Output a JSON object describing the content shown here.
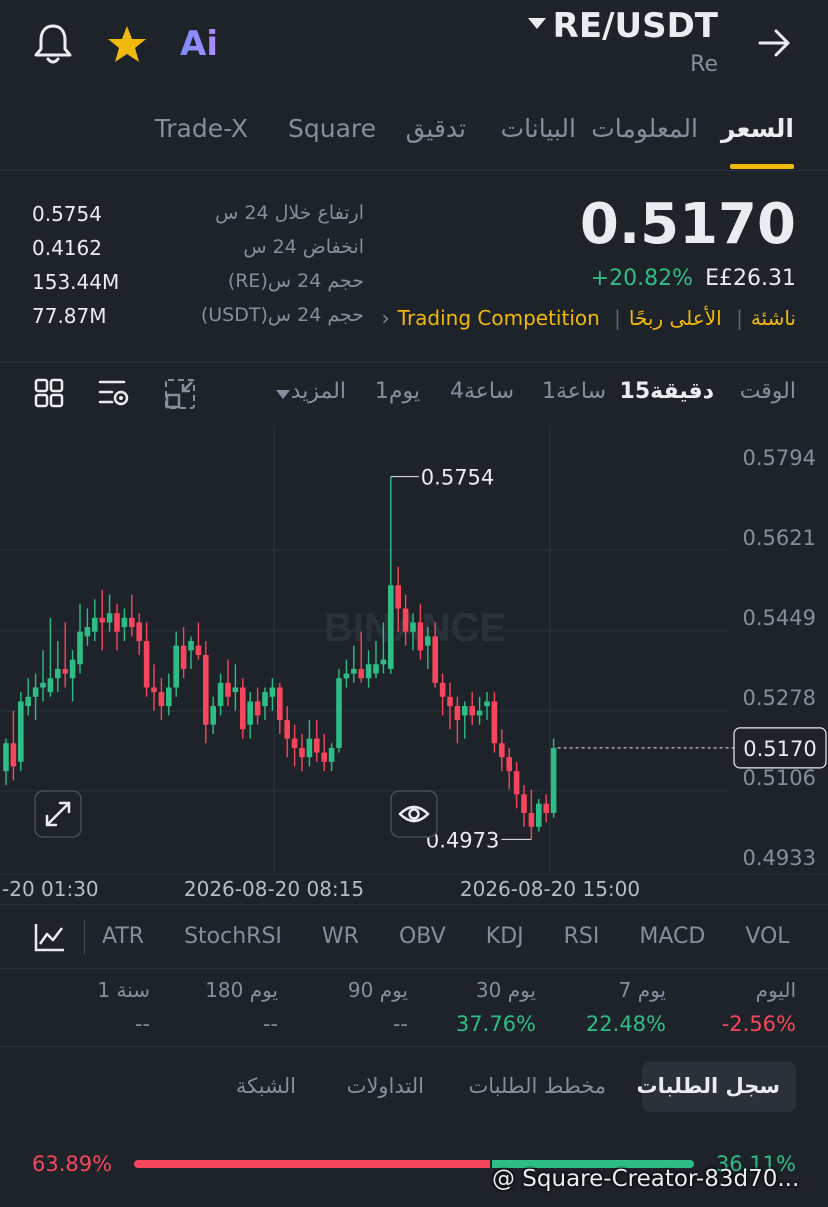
{
  "header": {
    "pair": "RE/USDT",
    "base_name": "Re",
    "ai_label": "Ai"
  },
  "tabs": [
    {
      "label": "السعر",
      "active": true
    },
    {
      "label": "المعلومات",
      "active": false
    },
    {
      "label": "البيانات",
      "active": false
    },
    {
      "label": "تدقيق",
      "active": false
    },
    {
      "label": "Square",
      "active": false
    },
    {
      "label": "Trade-X",
      "active": false
    }
  ],
  "stats": {
    "high_label": "ارتفاع خلال 24 س",
    "high_value": "0.5754",
    "low_label": "انخفاض 24 س",
    "low_value": "0.4162",
    "vol_base_label": "حجم 24 س(RE)",
    "vol_base_value": "153.44M",
    "vol_quote_label": "حجم 24 س(USDT)",
    "vol_quote_value": "77.87M"
  },
  "price": {
    "last": "0.5170",
    "change_pct": "+20.82%",
    "fiat": "E£26.31"
  },
  "tags": [
    "ناشئة",
    "الأعلى ربحًا",
    "Trading Competition"
  ],
  "timeframes": {
    "time_label": "الوقت",
    "items": [
      "15دقيقة",
      "1ساعة",
      "4ساعة",
      "1يوم"
    ],
    "active": "15دقيقة",
    "more_label": "المزيد"
  },
  "chart_data": {
    "type": "candlestick",
    "pair": "RE/USDT",
    "interval": "15m",
    "y_ticks": [
      "0.5794",
      "0.5621",
      "0.5449",
      "0.5278",
      "0.5106",
      "0.4933"
    ],
    "x_ticks": [
      "-20 01:30",
      "2026-08-20 08:15",
      "2026-08-20 15:00"
    ],
    "ylim": [
      0.4933,
      0.5794
    ],
    "last_price_label": "0.5170",
    "high_marker": "0.5754",
    "low_marker": "0.4973",
    "watermark": "BINANCE",
    "candles": [
      [
        0.512,
        0.519,
        0.509,
        0.518
      ],
      [
        0.518,
        0.525,
        0.51,
        0.513
      ],
      [
        0.514,
        0.529,
        0.512,
        0.527
      ],
      [
        0.526,
        0.532,
        0.524,
        0.528
      ],
      [
        0.528,
        0.533,
        0.523,
        0.53
      ],
      [
        0.53,
        0.538,
        0.527,
        0.531
      ],
      [
        0.529,
        0.545,
        0.528,
        0.532
      ],
      [
        0.532,
        0.54,
        0.529,
        0.534
      ],
      [
        0.534,
        0.544,
        0.53,
        0.533
      ],
      [
        0.532,
        0.538,
        0.527,
        0.536
      ],
      [
        0.535,
        0.548,
        0.533,
        0.542
      ],
      [
        0.541,
        0.547,
        0.539,
        0.543
      ],
      [
        0.542,
        0.549,
        0.54,
        0.545
      ],
      [
        0.545,
        0.551,
        0.538,
        0.544
      ],
      [
        0.544,
        0.55,
        0.542,
        0.546
      ],
      [
        0.546,
        0.548,
        0.538,
        0.542
      ],
      [
        0.543,
        0.547,
        0.54,
        0.545
      ],
      [
        0.545,
        0.55,
        0.541,
        0.543
      ],
      [
        0.544,
        0.546,
        0.537,
        0.54
      ],
      [
        0.54,
        0.544,
        0.528,
        0.53
      ],
      [
        0.53,
        0.535,
        0.525,
        0.529
      ],
      [
        0.529,
        0.532,
        0.523,
        0.526
      ],
      [
        0.526,
        0.533,
        0.524,
        0.53
      ],
      [
        0.53,
        0.542,
        0.528,
        0.539
      ],
      [
        0.539,
        0.543,
        0.532,
        0.534
      ],
      [
        0.538,
        0.541,
        0.534,
        0.54
      ],
      [
        0.539,
        0.544,
        0.536,
        0.537
      ],
      [
        0.537,
        0.54,
        0.518,
        0.522
      ],
      [
        0.522,
        0.528,
        0.52,
        0.526
      ],
      [
        0.526,
        0.533,
        0.524,
        0.531
      ],
      [
        0.531,
        0.536,
        0.526,
        0.528
      ],
      [
        0.529,
        0.535,
        0.525,
        0.53
      ],
      [
        0.53,
        0.532,
        0.519,
        0.521
      ],
      [
        0.522,
        0.529,
        0.519,
        0.527
      ],
      [
        0.527,
        0.53,
        0.522,
        0.524
      ],
      [
        0.526,
        0.53,
        0.523,
        0.529
      ],
      [
        0.528,
        0.532,
        0.525,
        0.53
      ],
      [
        0.53,
        0.531,
        0.52,
        0.523
      ],
      [
        0.523,
        0.526,
        0.515,
        0.519
      ],
      [
        0.519,
        0.522,
        0.513,
        0.517
      ],
      [
        0.517,
        0.52,
        0.512,
        0.515
      ],
      [
        0.515,
        0.523,
        0.513,
        0.519
      ],
      [
        0.519,
        0.523,
        0.514,
        0.516
      ],
      [
        0.516,
        0.52,
        0.512,
        0.514
      ],
      [
        0.514,
        0.518,
        0.512,
        0.517
      ],
      [
        0.517,
        0.534,
        0.516,
        0.532
      ],
      [
        0.532,
        0.536,
        0.53,
        0.533
      ],
      [
        0.533,
        0.539,
        0.531,
        0.534
      ],
      [
        0.534,
        0.542,
        0.531,
        0.532
      ],
      [
        0.532,
        0.538,
        0.53,
        0.535
      ],
      [
        0.533,
        0.54,
        0.532,
        0.535
      ],
      [
        0.535,
        0.544,
        0.533,
        0.536
      ],
      [
        0.534,
        0.5754,
        0.533,
        0.552
      ],
      [
        0.552,
        0.556,
        0.542,
        0.547
      ],
      [
        0.547,
        0.55,
        0.539,
        0.542
      ],
      [
        0.542,
        0.546,
        0.538,
        0.544
      ],
      [
        0.544,
        0.548,
        0.536,
        0.538
      ],
      [
        0.539,
        0.543,
        0.534,
        0.541
      ],
      [
        0.541,
        0.544,
        0.53,
        0.531
      ],
      [
        0.531,
        0.533,
        0.524,
        0.528
      ],
      [
        0.528,
        0.531,
        0.521,
        0.526
      ],
      [
        0.526,
        0.528,
        0.518,
        0.523
      ],
      [
        0.524,
        0.527,
        0.519,
        0.526
      ],
      [
        0.526,
        0.529,
        0.522,
        0.524
      ],
      [
        0.524,
        0.528,
        0.522,
        0.525
      ],
      [
        0.526,
        0.529,
        0.523,
        0.527
      ],
      [
        0.527,
        0.529,
        0.516,
        0.518
      ],
      [
        0.518,
        0.521,
        0.512,
        0.515
      ],
      [
        0.515,
        0.517,
        0.508,
        0.512
      ],
      [
        0.512,
        0.514,
        0.504,
        0.507
      ],
      [
        0.507,
        0.509,
        0.5,
        0.503
      ],
      [
        0.503,
        0.508,
        0.4973,
        0.5
      ],
      [
        0.5,
        0.506,
        0.499,
        0.505
      ],
      [
        0.505,
        0.507,
        0.501,
        0.503
      ],
      [
        0.503,
        0.519,
        0.502,
        0.517
      ]
    ]
  },
  "indicators": [
    "ATR",
    "StochRSI",
    "WR",
    "OBV",
    "KDJ",
    "RSI",
    "MACD",
    "VOL"
  ],
  "performance": [
    {
      "label": "اليوم",
      "value": "-2.56%",
      "color": "#f6465d"
    },
    {
      "label": "7 يوم",
      "value": "22.48%",
      "color": "#2ebd85"
    },
    {
      "label": "30 يوم",
      "value": "37.76%",
      "color": "#2ebd85"
    },
    {
      "label": "90 يوم",
      "value": "--",
      "color": "#848e9c"
    },
    {
      "label": "180 يوم",
      "value": "--",
      "color": "#848e9c"
    },
    {
      "label": "1 سنة",
      "value": "--",
      "color": "#848e9c"
    }
  ],
  "order_tabs": [
    "سجل الطلبات",
    "مخطط الطلبات",
    "التداولات",
    "الشبكة"
  ],
  "ratio": {
    "sell_pct": "63.89%",
    "buy_pct": "36.11%",
    "sell_fraction": 0.6389
  },
  "watermark_text": "@ Square-Creator-83d70...",
  "colors": {
    "background": "#1e2329",
    "up": "#2ebd85",
    "down": "#f6465d",
    "accent": "#f0b90b"
  }
}
